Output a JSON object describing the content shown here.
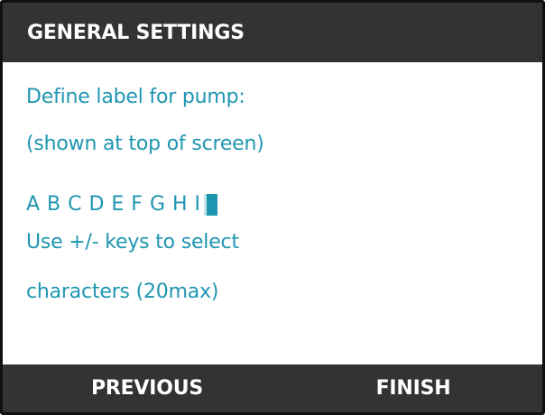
{
  "screen": {
    "title": "GENERAL SETTINGS"
  },
  "content": {
    "prompt_line_1": "Define label for pump:",
    "prompt_line_2": "(shown at top of screen)",
    "label_value": "A B C D E F G H I",
    "instruction_line_1": "Use +/- keys to select",
    "instruction_line_2": "characters (20max)"
  },
  "softkeys": {
    "left_label": "PREVIOUS",
    "right_label": "FINISH"
  },
  "colors": {
    "header_background": "#333333",
    "header_text": "#ffffff",
    "content_text": "#1f96b0",
    "cursor": "#1f96b0"
  }
}
